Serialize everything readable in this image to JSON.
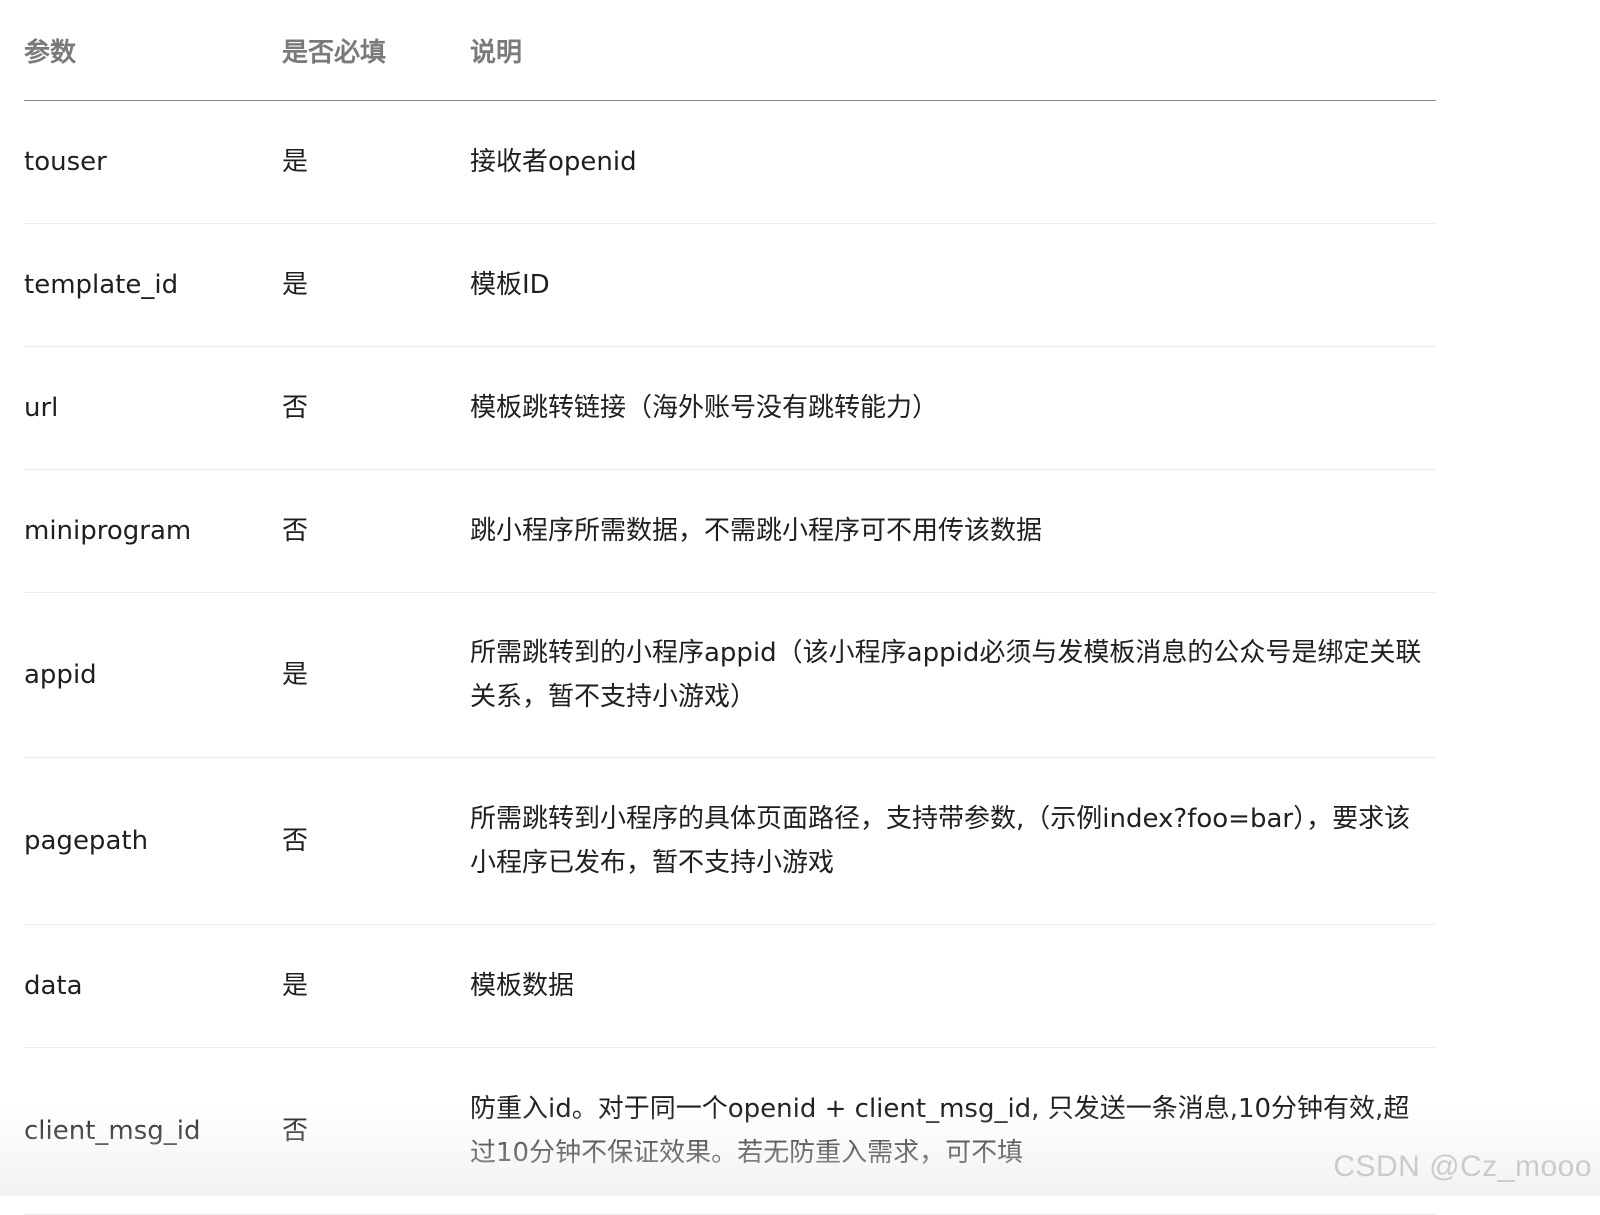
{
  "table": {
    "headers": {
      "param": "参数",
      "required": "是否必填",
      "desc": "说明"
    },
    "rows": [
      {
        "param": "touser",
        "required": "是",
        "desc": "接收者openid"
      },
      {
        "param": "template_id",
        "required": "是",
        "desc": "模板ID"
      },
      {
        "param": "url",
        "required": "否",
        "desc": "模板跳转链接（海外账号没有跳转能力）"
      },
      {
        "param": "miniprogram",
        "required": "否",
        "desc": "跳小程序所需数据，不需跳小程序可不用传该数据"
      },
      {
        "param": "appid",
        "required": "是",
        "desc": "所需跳转到的小程序appid（该小程序appid必须与发模板消息的公众号是绑定关联关系，暂不支持小游戏）"
      },
      {
        "param": "pagepath",
        "required": "否",
        "desc": "所需跳转到小程序的具体页面路径，支持带参数,（示例index?foo=bar），要求该小程序已发布，暂不支持小游戏"
      },
      {
        "param": "data",
        "required": "是",
        "desc": "模板数据"
      },
      {
        "param": "client_msg_id",
        "required": "否",
        "desc": "防重入id。对于同一个openid + client_msg_id, 只发送一条消息,10分钟有效,超过10分钟不保证效果。若无防重入需求，可不填"
      }
    ]
  },
  "watermark": "CSDN @Cz_mooo"
}
